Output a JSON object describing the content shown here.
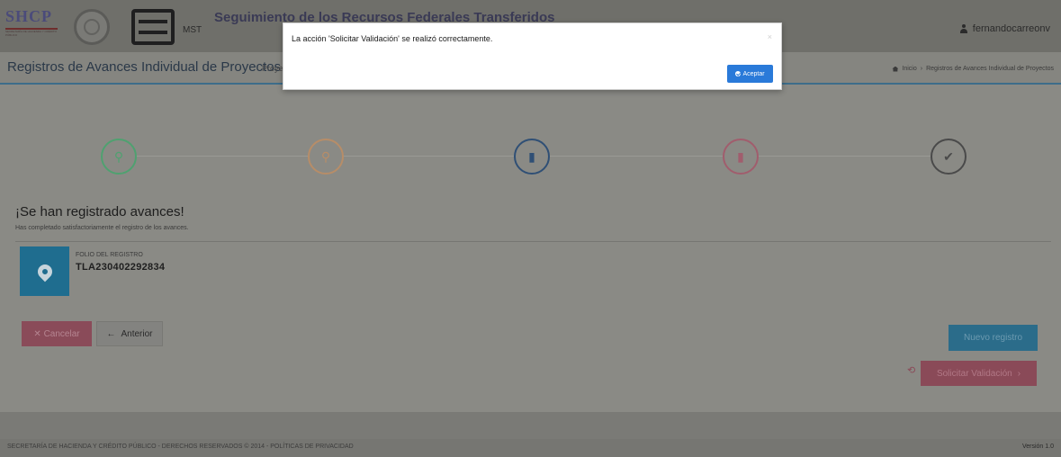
{
  "header": {
    "brand": "SHCP",
    "brand_sub": "SECRETARÍA DE HACIENDA Y CRÉDITO PÚBLICO",
    "mst_label": "MST",
    "app_title": "Seguimiento de los Recursos Federales Transferidos",
    "user": "fernandocarreonv"
  },
  "titlebar": {
    "title": "Registros de Avances Individual de Proyectos",
    "subtitle": "Proyecto",
    "breadcrumb_home": "Inicio",
    "breadcrumb_current": "Registros de Avances Individual de Proyectos"
  },
  "steps": [
    {
      "icon": "map-pin-icon",
      "glyph": "⚲",
      "color": "#4fa170"
    },
    {
      "icon": "pin-outline-icon",
      "glyph": "⚲",
      "color": "#b78d68"
    },
    {
      "icon": "document-icon",
      "glyph": "▮",
      "color": "#2f4f75"
    },
    {
      "icon": "pdf-icon",
      "glyph": "▮",
      "color": "#a15d6d"
    },
    {
      "icon": "check-icon",
      "glyph": "✔",
      "color": "#4a4a4a"
    }
  ],
  "content": {
    "heading": "¡Se han registrado avances!",
    "text": "Has completado satisfactoriamente el registro de los avances.",
    "folio_label": "FOLIO DEL REGISTRO",
    "folio_value": "TLA230402292834"
  },
  "buttons": {
    "cancel": "✕ Cancelar",
    "prev": "Anterior",
    "blue": "Nuevo registro",
    "pink": "Solicitar Validación"
  },
  "footer": {
    "text": "SECRETARÍA DE HACIENDA Y CRÉDITO PÚBLICO - DERECHOS RESERVADOS © 2014 - POLÍTICAS DE PRIVACIDAD",
    "version": "Versión 1.0"
  },
  "modal": {
    "message": "La acción 'Solicitar Validación' se realizó correctamente.",
    "close": "×",
    "ok_label": "Aceptar",
    "ok_color": "#2a7ad9"
  }
}
